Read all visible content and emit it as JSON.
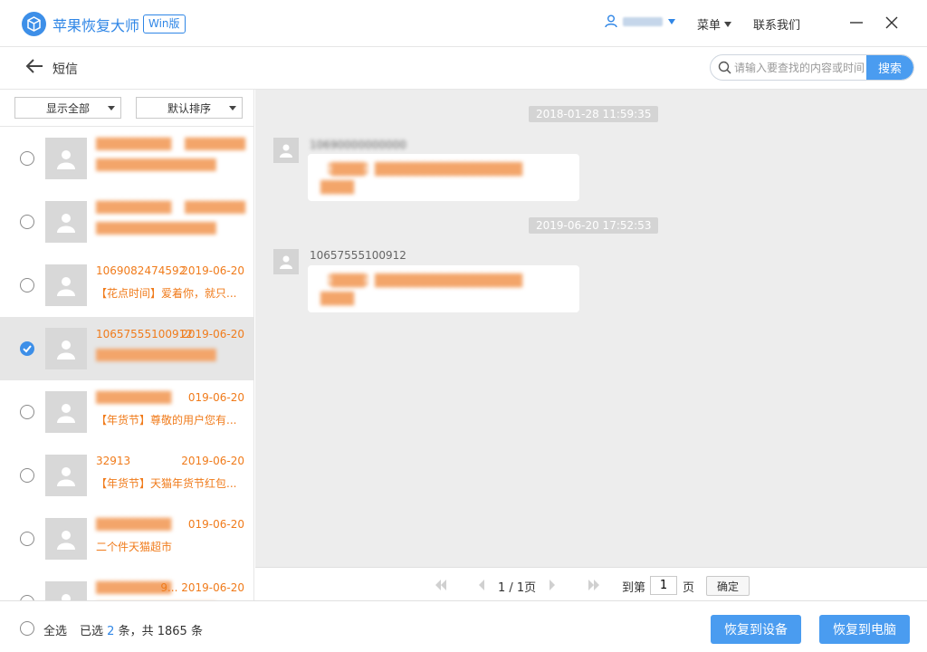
{
  "app": {
    "title": "苹果恢复大师",
    "badge": "Win版",
    "menu_label": "菜单",
    "contact_label": "联系我们"
  },
  "header": {
    "page_title": "短信",
    "search_placeholder": "请输入要查找的内容或时间",
    "search_button": "搜索"
  },
  "filters": {
    "show": "显示全部",
    "sort": "默认排序"
  },
  "list": [
    {
      "sender": "",
      "date": "",
      "preview": "",
      "checked": false,
      "selected": false
    },
    {
      "sender": "",
      "date": "",
      "preview": "",
      "checked": false,
      "selected": false
    },
    {
      "sender": "1069082474592",
      "date": "2019-06-20",
      "preview": "【花点时间】爱着你，就只...",
      "checked": false,
      "selected": false
    },
    {
      "sender": "10657555100912",
      "date": "2019-06-20",
      "preview": "",
      "checked": true,
      "selected": true
    },
    {
      "sender": "",
      "date": "019-06-20",
      "preview": "【年货节】尊敬的用户您有...",
      "checked": false,
      "selected": false
    },
    {
      "sender": "32913",
      "date": "2019-06-20",
      "preview": "【年货节】天猫年货节红包...",
      "checked": false,
      "selected": false
    },
    {
      "sender": "",
      "date": "019-06-20",
      "preview": "二个件天猫超市",
      "checked": false,
      "selected": false
    },
    {
      "sender": "",
      "date": "9... 2019-06-20",
      "preview": "",
      "checked": false,
      "selected": false
    }
  ],
  "chat": {
    "messages": [
      {
        "time": "2018-01-28 11:59:35",
        "sender": ""
      },
      {
        "time": "2019-06-20 17:52:53",
        "sender": "10657555100912"
      }
    ]
  },
  "pager": {
    "page_info": "1 / 1页",
    "goto_label": "到第",
    "page_value": "1",
    "page_unit": "页",
    "ok": "确定"
  },
  "footer": {
    "select_all": "全选",
    "selected_prefix": "已选",
    "selected_count": "2",
    "selected_mid": "条，共",
    "total": "1865",
    "selected_suffix": "条",
    "restore_device": "恢复到设备",
    "restore_pc": "恢复到电脑"
  },
  "colors": {
    "accent": "#4a9cf0",
    "brand": "#2f86e6",
    "sender_orange": "#f07b1b",
    "chat_bg": "#ededed"
  }
}
